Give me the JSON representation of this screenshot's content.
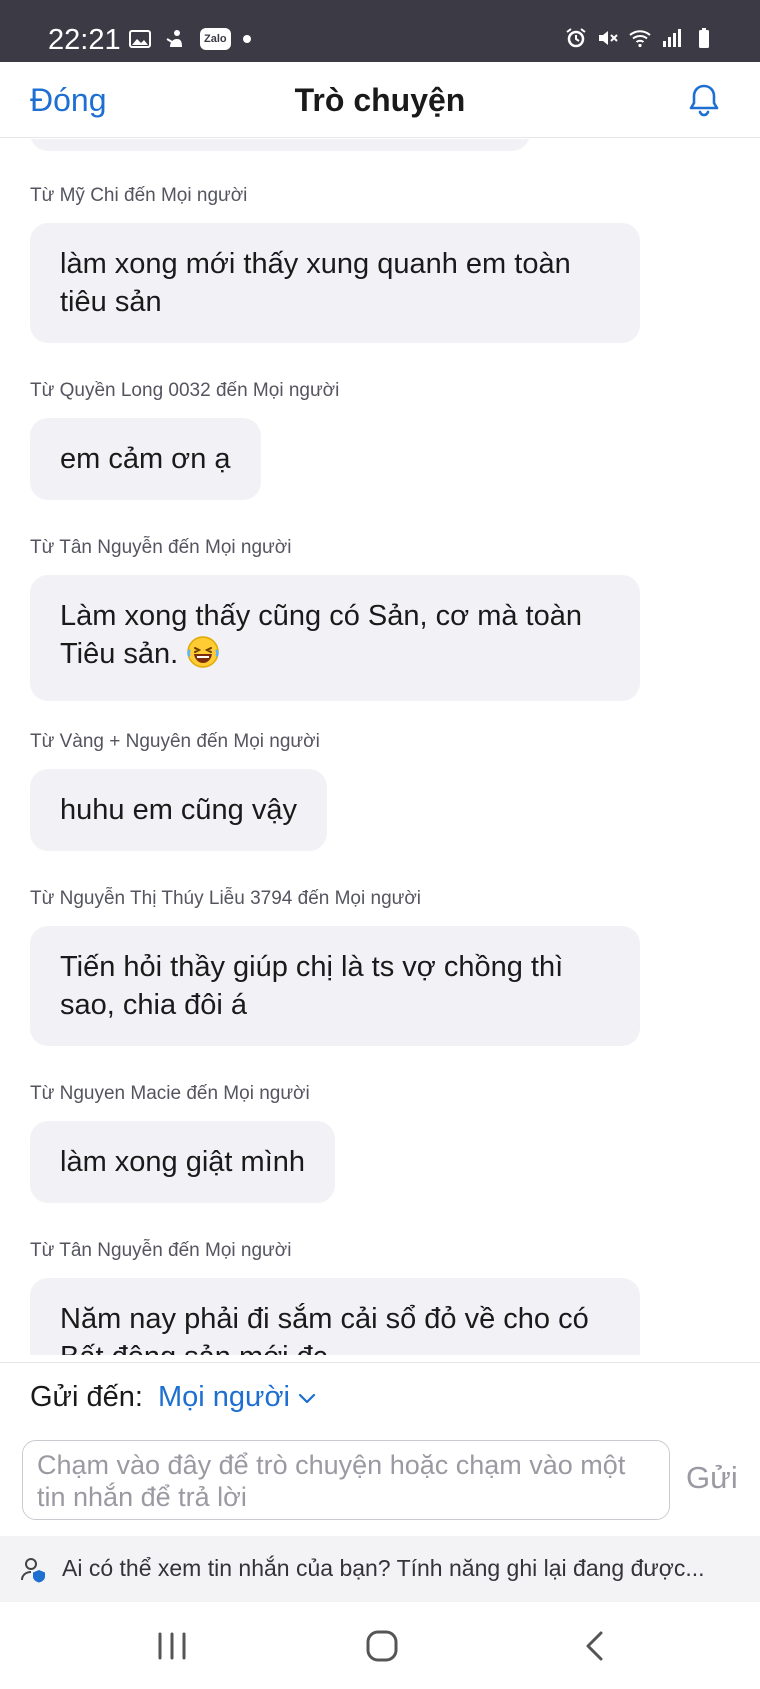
{
  "status_bar": {
    "time": "22:21",
    "left_icons": [
      "image-icon",
      "notification-icon",
      "zalo-icon",
      "dot-icon"
    ],
    "zalo_label": "Zalo",
    "right_icons": [
      "alarm-icon",
      "mute-icon",
      "wifi-icon",
      "signal-icon",
      "battery-icon"
    ]
  },
  "header": {
    "close_label": "Đóng",
    "title": "Trò chuyện",
    "bell_icon": "bell-icon"
  },
  "messages": [
    {
      "sender": "Từ Mỹ Chi đến Mọi người",
      "text": "làm xong mới thấy xung quanh em toàn tiêu sản"
    },
    {
      "sender": "Từ Quyền Long 0032 đến Mọi người",
      "text": "em cảm ơn ạ"
    },
    {
      "sender": "Từ Tân Nguyễn đến Mọi người",
      "text": "Làm xong thấy cũng có Sản, cơ mà toàn Tiêu sản.",
      "emoji": "😂"
    },
    {
      "sender": "Từ Vàng + Nguyên đến Mọi người",
      "text": "huhu em cũng vậy"
    },
    {
      "sender": "Từ Nguyễn Thị Thúy Liễu 3794 đến Mọi người",
      "text": "Tiến hỏi thầy giúp chị là ts vợ chồng thì sao, chia đôi á"
    },
    {
      "sender": "Từ Nguyen Macie đến Mọi người",
      "text": "làm xong giật mình"
    },
    {
      "sender": "Từ Tân Nguyễn đến Mọi người",
      "text": "Năm nay phải đi sắm cải sổ đỏ về cho có Bất động sản mới đc"
    }
  ],
  "composer": {
    "send_to_label": "Gửi đến:",
    "recipient": "Mọi người",
    "placeholder": "Chạm vào đây để trò chuyện hoặc chạm vào một tin nhắn để trả lời",
    "send_label": "Gửi"
  },
  "privacy_notice": "Ai có thể xem tin nhắn của bạn? Tính năng ghi lại đang được...",
  "nav_bar": {
    "icons": [
      "recent-apps-icon",
      "home-icon",
      "back-icon"
    ]
  },
  "colors": {
    "accent": "#1d6fd1",
    "status_bar_bg": "#3b3a45",
    "bubble_bg": "#f2f2f6"
  }
}
